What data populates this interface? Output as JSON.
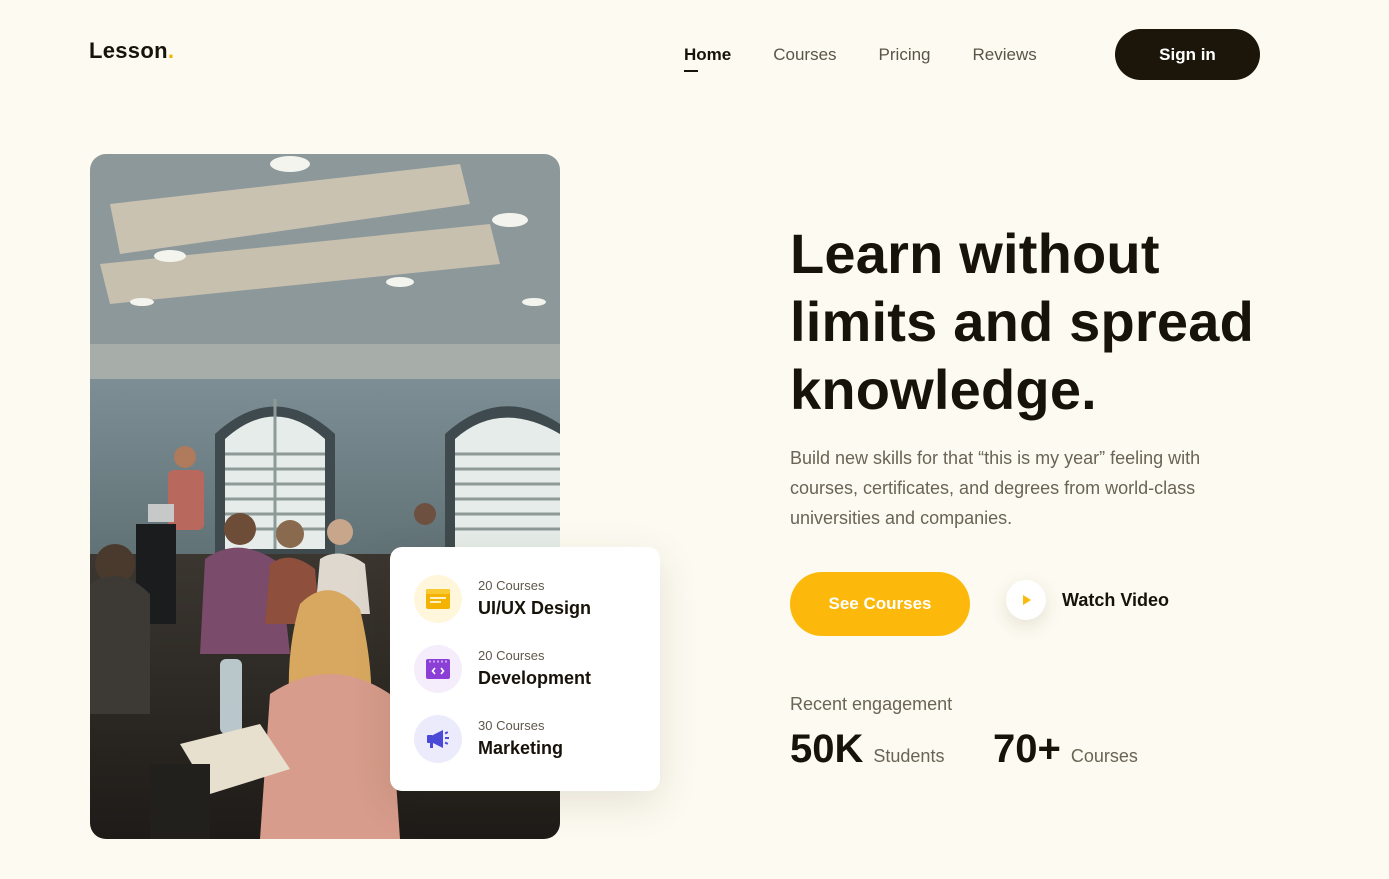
{
  "brand": {
    "name": "Lesson",
    "dot": "."
  },
  "nav": {
    "items": [
      {
        "label": "Home",
        "active": true
      },
      {
        "label": "Courses",
        "active": false
      },
      {
        "label": "Pricing",
        "active": false
      },
      {
        "label": "Reviews",
        "active": false
      }
    ],
    "signin_label": "Sign in"
  },
  "hero": {
    "headline": "Learn without limits and spread knowledge.",
    "subtext": "Build new skills for that “this is my year” feeling with courses, certificates, and degrees from world-class universities and companies.",
    "primary_cta": "See Courses",
    "secondary_cta": "Watch Video",
    "engagement_label": "Recent engagement",
    "stats": [
      {
        "value": "50K",
        "unit": "Students"
      },
      {
        "value": "70+",
        "unit": "Courses"
      }
    ]
  },
  "course_categories": [
    {
      "count": "20 Courses",
      "name": "UI/UX Design",
      "icon": "layout-window-icon",
      "icon_color": "#f5b301",
      "bg_color": "#fff6dc"
    },
    {
      "count": "20 Courses",
      "name": "Development",
      "icon": "code-window-icon",
      "icon_color": "#8b3fd6",
      "bg_color": "#f5ecfc"
    },
    {
      "count": "30 Courses",
      "name": "Marketing",
      "icon": "megaphone-icon",
      "icon_color": "#4b49d8",
      "bg_color": "#ecebfb"
    }
  ],
  "colors": {
    "background": "#fdfaf1",
    "accent": "#fcb80b",
    "dark": "#1b1609"
  }
}
